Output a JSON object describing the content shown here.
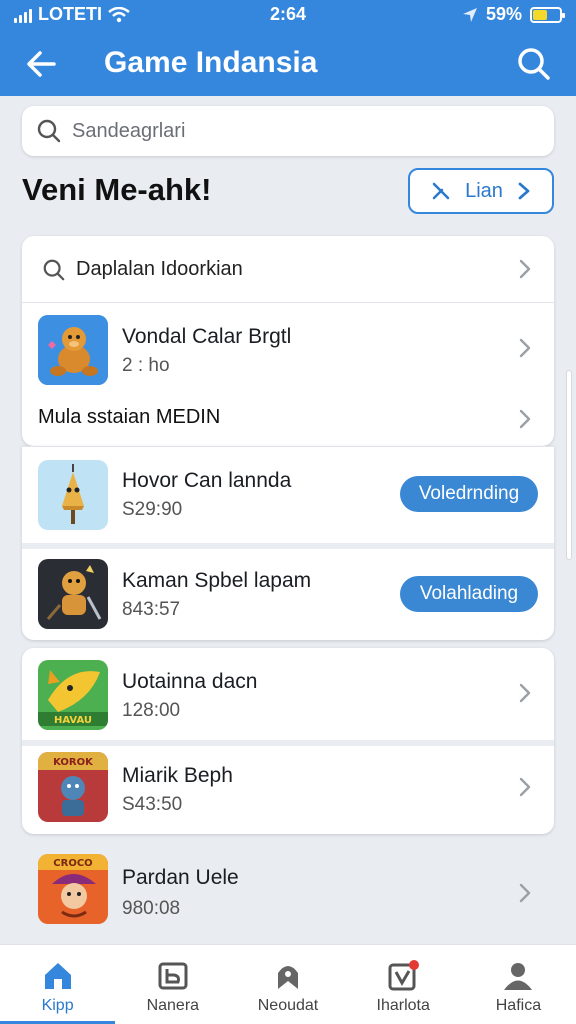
{
  "status_bar": {
    "carrier": "LOTETI",
    "time": "2:64",
    "battery": "59%",
    "battery_level": 0.55
  },
  "header": {
    "title": "Game Indansia"
  },
  "search": {
    "placeholder": "Sandeagrlari"
  },
  "section": {
    "title": "Veni Me-ahk!",
    "action_label": "Lian"
  },
  "featured_card": {
    "search_row_label": "Daplalan Idoorkian",
    "game": {
      "name": "Vondal Calar Brgtl",
      "sub": "2 : ho"
    },
    "more_row_label": "Mula sstaian MEDIN"
  },
  "install_card": {
    "items": [
      {
        "name": "Hovor Can lannda",
        "price": "S29:90",
        "button": "Voledrnding"
      },
      {
        "name": "Kaman Spbel lapam",
        "price": "843:57",
        "button": "Volahlading"
      }
    ]
  },
  "list_card_1": {
    "items": [
      {
        "name": "Uotainna dacn",
        "price": "128:00"
      },
      {
        "name": "Miarik Beph",
        "price": "S43:50"
      }
    ]
  },
  "list_card_2": {
    "items": [
      {
        "name": "Pardan Uele",
        "price": "980:08"
      }
    ]
  },
  "thumb_labels": {
    "game4": "HAVAU",
    "game5": "KOROK",
    "game6": "CROCO"
  },
  "bottom_nav": {
    "items": [
      {
        "label": "Kipp",
        "icon": "home-icon",
        "active": true
      },
      {
        "label": "Nanera",
        "icon": "box-icon",
        "active": false
      },
      {
        "label": "Neoudat",
        "icon": "badge-icon",
        "active": false
      },
      {
        "label": "Iharlota",
        "icon": "notification-icon",
        "active": false
      },
      {
        "label": "Hafica",
        "icon": "profile-icon",
        "active": false
      }
    ]
  },
  "colors": {
    "primary": "#3487dd",
    "background": "#e9edf2",
    "button": "#3a87d4",
    "battery": "#f4d92a",
    "badge_dot": "#e53935"
  }
}
